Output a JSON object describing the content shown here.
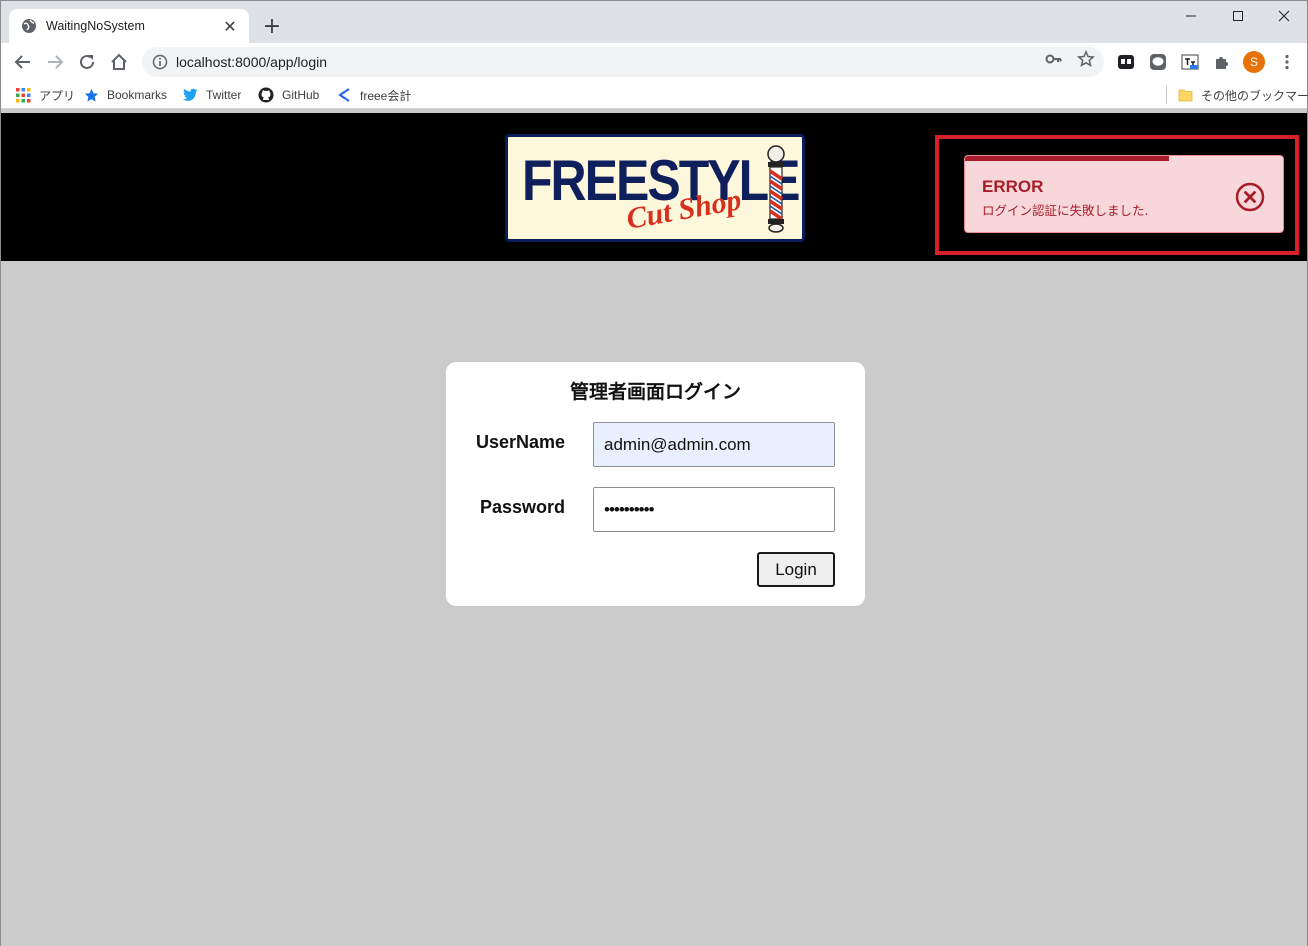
{
  "browser": {
    "tab_title": "WaitingNoSystem",
    "tab_close": "✕",
    "new_tab": "+",
    "url": "localhost:8000/app/login",
    "profile_initial": "S",
    "bookmarks": [
      {
        "label": "アプリ",
        "icon": "apps-grid-icon"
      },
      {
        "label": "Bookmarks",
        "icon": "star-icon"
      },
      {
        "label": "Twitter",
        "icon": "twitter-icon"
      },
      {
        "label": "GitHub",
        "icon": "github-icon"
      },
      {
        "label": "freee会計",
        "icon": "freee-icon"
      }
    ],
    "other_bookmarks": "その他のブックマーク"
  },
  "header": {
    "logo_main": "FREESTYLE",
    "logo_sub": "Cut Shop"
  },
  "toast": {
    "title": "ERROR",
    "message": "ログイン認証に失敗しました.",
    "progress": 0.64
  },
  "login": {
    "title": "管理者画面ログイン",
    "username_label": "UserName",
    "username_value": "admin@admin.com",
    "password_label": "Password",
    "password_value": "••••••••••",
    "submit_label": "Login"
  },
  "colors": {
    "error_text": "#a71d2a",
    "error_bg": "#f8d7da",
    "highlight": "#d6202a",
    "autofill_bg": "#e8f0fe"
  }
}
